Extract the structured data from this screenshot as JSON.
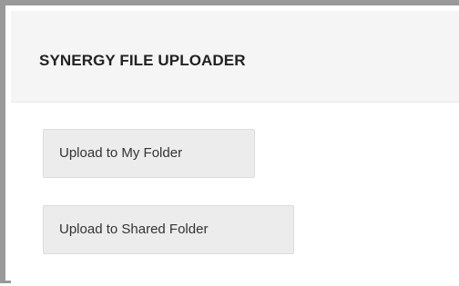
{
  "header": {
    "title": "SYNERGY FILE UPLOADER"
  },
  "actions": {
    "upload_my_folder_label": "Upload to My Folder",
    "upload_shared_folder_label": "Upload to Shared Folder"
  },
  "colors": {
    "frame_border": "#999999",
    "header_background": "#f5f5f5",
    "button_background": "#ececec",
    "button_border": "#dcdcdc",
    "title_text": "#222222",
    "button_text": "#333333"
  }
}
